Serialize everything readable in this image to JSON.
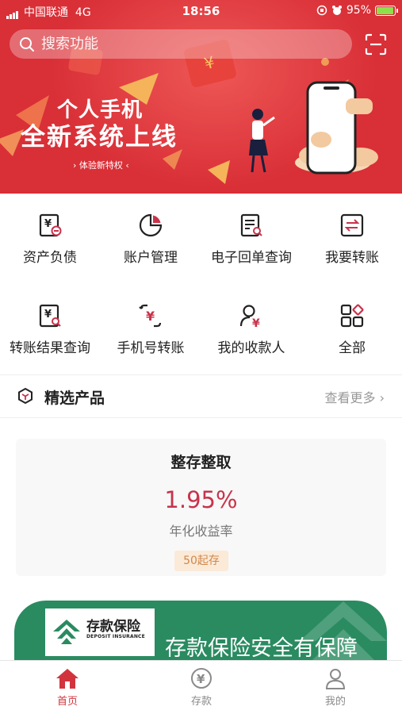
{
  "status_bar": {
    "carrier": "中国联通",
    "network": "4G",
    "time": "18:56",
    "battery": "95%"
  },
  "search": {
    "placeholder": "搜索功能"
  },
  "banner": {
    "title_line1": "个人手机",
    "title_line2": "全新系统上线",
    "subtitle": "› 体验新特权 ‹"
  },
  "features": [
    {
      "label": "资产负债",
      "icon": "asset-liability-icon"
    },
    {
      "label": "账户管理",
      "icon": "pie-chart-icon"
    },
    {
      "label": "电子回单查询",
      "icon": "receipt-search-icon"
    },
    {
      "label": "我要转账",
      "icon": "transfer-icon"
    },
    {
      "label": "转账结果查询",
      "icon": "transfer-result-icon"
    },
    {
      "label": "手机号转账",
      "icon": "phone-transfer-icon"
    },
    {
      "label": "我的收款人",
      "icon": "payee-icon"
    },
    {
      "label": "全部",
      "icon": "all-apps-icon"
    }
  ],
  "section": {
    "title": "精选产品",
    "more": "查看更多"
  },
  "product": {
    "name": "整存整取",
    "rate": "1.95%",
    "rate_label": "年化收益率",
    "min_deposit_tag": "50起存"
  },
  "insurance_banner": {
    "logo_name": "存款保险",
    "logo_en": "DEPOSIT INSURANCE",
    "slogan": "存款保险安全有保障"
  },
  "tabs": [
    {
      "label": "首页",
      "active": true
    },
    {
      "label": "存款",
      "active": false
    },
    {
      "label": "我的",
      "active": false
    }
  ],
  "colors": {
    "brand_red": "#d92f37",
    "accent_red": "#c8334b",
    "insurance_green": "#2a8b61",
    "tag_orange": "#d0884c"
  }
}
